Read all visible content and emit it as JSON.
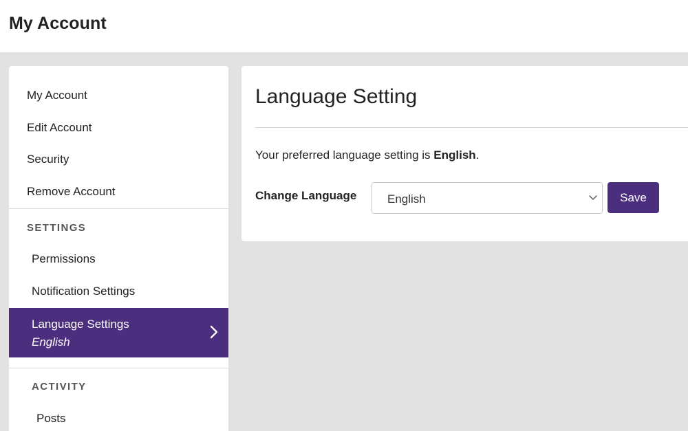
{
  "header": {
    "title": "My Account"
  },
  "sidebar": {
    "account_items": [
      {
        "label": "My Account"
      },
      {
        "label": "Edit Account"
      },
      {
        "label": "Security"
      },
      {
        "label": "Remove Account"
      }
    ],
    "settings_section": {
      "label": "SETTINGS",
      "items": [
        {
          "label": "Permissions"
        },
        {
          "label": "Notification Settings"
        }
      ],
      "active_item": {
        "label": "Language Settings",
        "sublabel": "English",
        "icon": "chevron-right-icon"
      }
    },
    "activity_section": {
      "label": "ACTIVITY",
      "items": [
        {
          "label": "Posts"
        }
      ]
    }
  },
  "main": {
    "title": "Language Setting",
    "preferred_prefix": "Your preferred language setting is ",
    "preferred_value": "English",
    "preferred_suffix": ".",
    "change_label": "Change Language",
    "select_value": "English",
    "save_label": "Save"
  },
  "colors": {
    "accent": "#4b2e7e",
    "background": "#e2e2e2",
    "surface": "#ffffff"
  }
}
